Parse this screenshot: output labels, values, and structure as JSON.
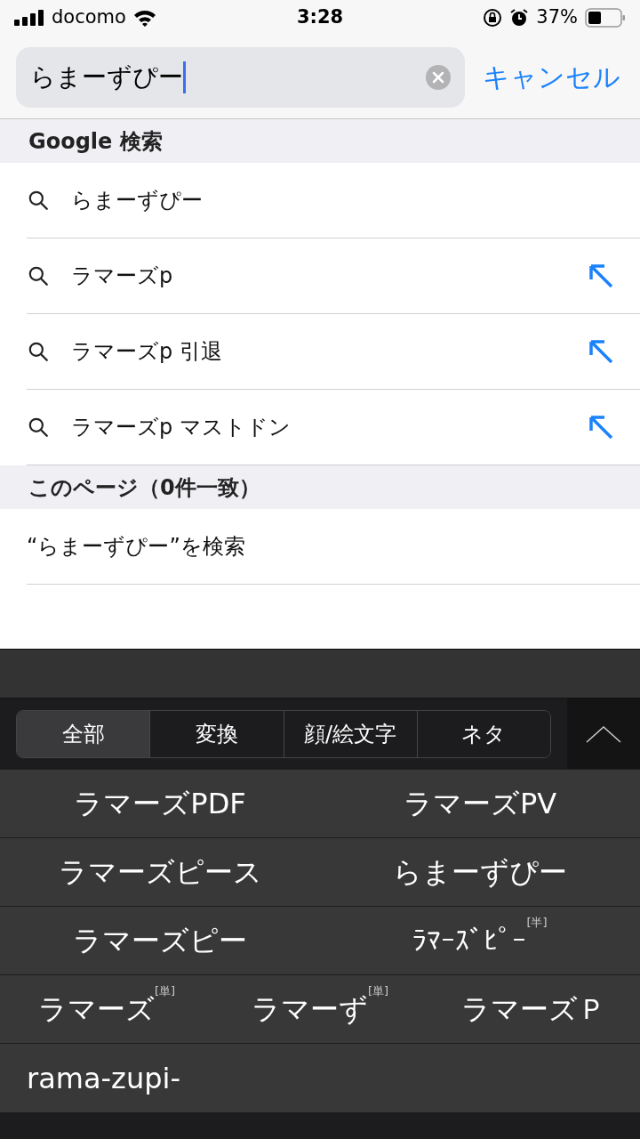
{
  "status_bar": {
    "carrier": "docomo",
    "time": "3:28",
    "battery": "37%"
  },
  "search": {
    "value": "らまーずぴー",
    "cancel": "キャンセル"
  },
  "sections": [
    {
      "title": "Google 検索",
      "items": [
        {
          "kind": "suggestion",
          "text": "らまーずぴー",
          "fill_arrow": false
        },
        {
          "kind": "suggestion",
          "text": "ラマーズp",
          "fill_arrow": true
        },
        {
          "kind": "suggestion",
          "text": "ラマーズp 引退",
          "fill_arrow": true
        },
        {
          "kind": "suggestion",
          "text": "ラマーズp マストドン",
          "fill_arrow": true
        }
      ]
    },
    {
      "title": "このページ（0件一致）",
      "items": [
        {
          "kind": "find",
          "text": "“らまーずぴー”を検索",
          "fill_arrow": false
        }
      ]
    }
  ],
  "keyboard": {
    "tabs": [
      {
        "label": "全部",
        "selected": true
      },
      {
        "label": "変換",
        "selected": false
      },
      {
        "label": "顔/絵文字",
        "selected": false
      },
      {
        "label": "ネタ",
        "selected": false
      }
    ],
    "candidate_rows": [
      [
        {
          "text": "ラマーズPDF"
        },
        {
          "text": "ラマーズPV"
        }
      ],
      [
        {
          "text": "ラマーズピース"
        },
        {
          "text": "らまーずぴー"
        }
      ],
      [
        {
          "text": "ラマーズピー"
        },
        {
          "text": "ﾗﾏｰｽﾞﾋﾟｰ",
          "tag": "[半]"
        }
      ],
      [
        {
          "text": "ラマーズ",
          "tag": "[単]"
        },
        {
          "text": "ラマーず",
          "tag": "[単]"
        },
        {
          "text": "ラマーズＰ"
        }
      ],
      [
        {
          "text": "rama-zupi-"
        }
      ]
    ]
  }
}
